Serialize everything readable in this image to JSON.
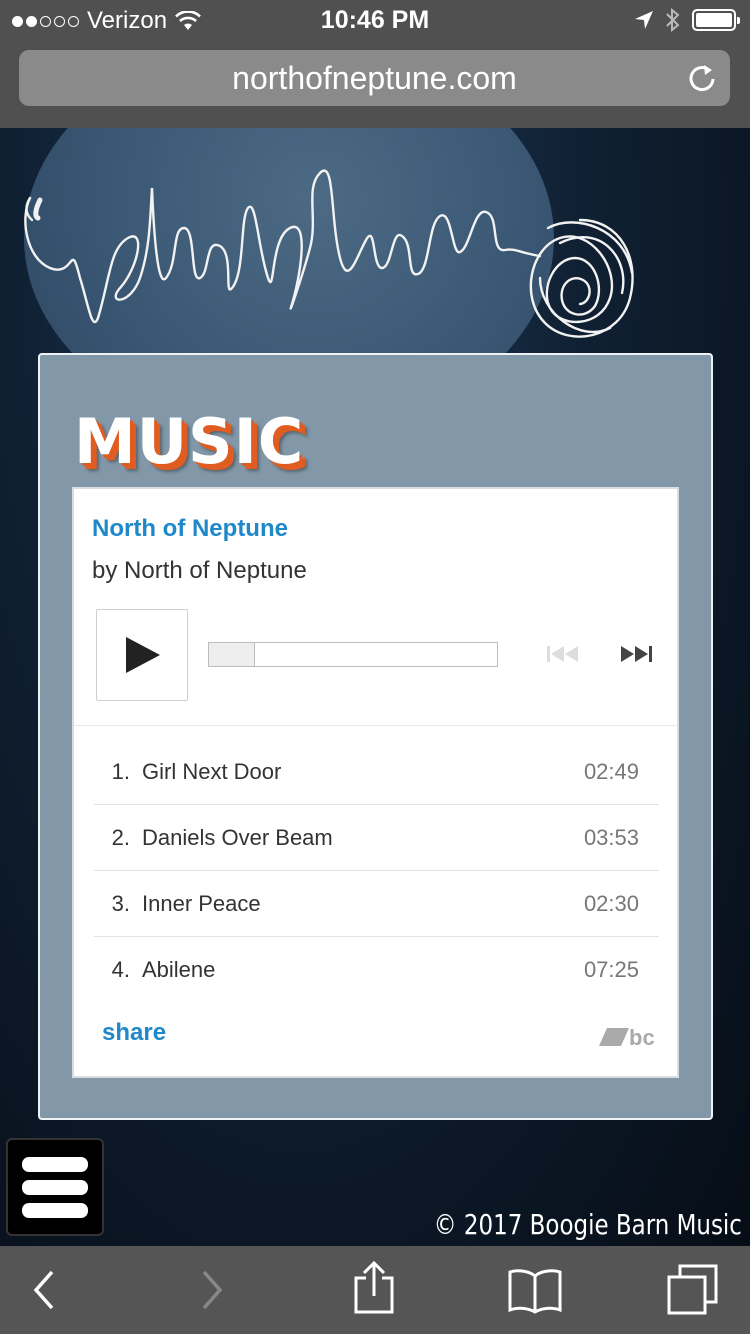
{
  "status_bar": {
    "carrier": "Verizon",
    "time": "10:46 PM",
    "signal_bars_filled": 2,
    "signal_bars_total": 5,
    "icons": [
      "wifi-icon",
      "location-arrow-icon",
      "bluetooth-icon",
      "battery-icon"
    ]
  },
  "browser": {
    "url": "northofneptune.com",
    "reload_icon": "reload-icon"
  },
  "site": {
    "logo_text": "northofNeptune",
    "section_title": "MUSIC",
    "copyright": "© 2017 Boogie Barn Music",
    "menu_icon": "hamburger-menu-icon"
  },
  "player": {
    "album": "North of Neptune",
    "artist_line": "by North of Neptune",
    "progress": 0.16,
    "tracks": [
      {
        "num": "1.",
        "title": "Girl Next Door",
        "time": "02:49"
      },
      {
        "num": "2.",
        "title": "Daniels Over Beam",
        "time": "03:53"
      },
      {
        "num": "3.",
        "title": "Inner Peace",
        "time": "02:30"
      },
      {
        "num": "4.",
        "title": "Abilene",
        "time": "07:25"
      }
    ],
    "share_label": "share",
    "brand_mark": "bc"
  },
  "toolbar": {
    "icons": [
      "back-icon",
      "forward-icon",
      "share-icon",
      "bookmarks-icon",
      "tabs-icon"
    ]
  },
  "colors": {
    "accent_blue": "#1e88c8",
    "title_shadow": "#e05d22",
    "panel": "#8298a8"
  }
}
